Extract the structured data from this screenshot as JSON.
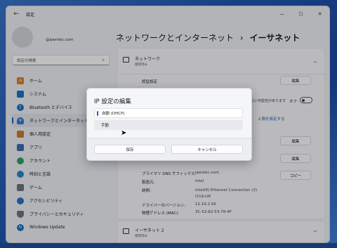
{
  "window": {
    "title": "設定",
    "back_glyph": "←",
    "controls": [
      "—",
      "☐",
      "✕"
    ]
  },
  "account": {
    "email": "@ipentec.com"
  },
  "search": {
    "placeholder": "設定の検索",
    "icon": "search-icon"
  },
  "nav": {
    "items": [
      {
        "label": "ホーム",
        "icon": "home-icon",
        "color": "#d9812b"
      },
      {
        "label": "システム",
        "icon": "system-icon",
        "color": "#1d73c9"
      },
      {
        "label": "Bluetooth とデバイス",
        "icon": "bluetooth-icon",
        "color": "#1d73c9"
      },
      {
        "label": "ネットワークとインターネット",
        "icon": "network-icon",
        "color": "#2f7fd2",
        "active": true
      },
      {
        "label": "個人用設定",
        "icon": "personalization-icon",
        "color": "#d07a2c"
      },
      {
        "label": "アプリ",
        "icon": "apps-icon",
        "color": "#3c6db0"
      },
      {
        "label": "アカウント",
        "icon": "account-icon",
        "color": "#2aa36b"
      },
      {
        "label": "時刻と言語",
        "icon": "time-language-icon",
        "color": "#2b86c9"
      },
      {
        "label": "ゲーム",
        "icon": "gaming-icon",
        "color": "#6b7480"
      },
      {
        "label": "アクセシビリティ",
        "icon": "accessibility-icon",
        "color": "#2a73c6"
      },
      {
        "label": "プライバシーとセキュリティ",
        "icon": "privacy-icon",
        "color": "#6b7480"
      },
      {
        "label": "Windows Update",
        "icon": "update-icon",
        "color": "#1d73c9"
      }
    ]
  },
  "header": {
    "parent": "ネットワークとインターネット",
    "separator": "›",
    "current": "イーサネット"
  },
  "ethernet_card": {
    "title": "ネットワーク",
    "subtitle": "接続済み",
    "chevron": "︿"
  },
  "settings": {
    "auth_label": "認証設定",
    "edit_label": "編集",
    "metered_suffix": "ットは従量制課金接続ではない可能性があります。",
    "toggle_text": "オフ",
    "data_limit_link": "上限を設定する",
    "copy_label": "コピー"
  },
  "properties": [
    {
      "label": "プライマリ DNS サフィックス:",
      "value": "ipentec.com"
    },
    {
      "label": "製造元:",
      "value": "Intel"
    },
    {
      "label": "説明:",
      "value": "Intel(R) Ethernet Connection (2) I219-LM"
    },
    {
      "label": "ドライバーのバージョン:",
      "value": "12.19.2.56"
    },
    {
      "label": "物理アドレス (MAC):",
      "value": "3C-52-82-53-78-4F"
    }
  ],
  "ethernet2_card": {
    "title": "イーサネット 2",
    "subtitle": "接続済み",
    "chevron": "﹀"
  },
  "dialog": {
    "title": "IP 設定の編集",
    "selected_option": "自動 (DHCP)",
    "hover_option": "手動",
    "save_label": "保存",
    "cancel_label": "キャンセル"
  },
  "accent_color": "#1a5fc0"
}
